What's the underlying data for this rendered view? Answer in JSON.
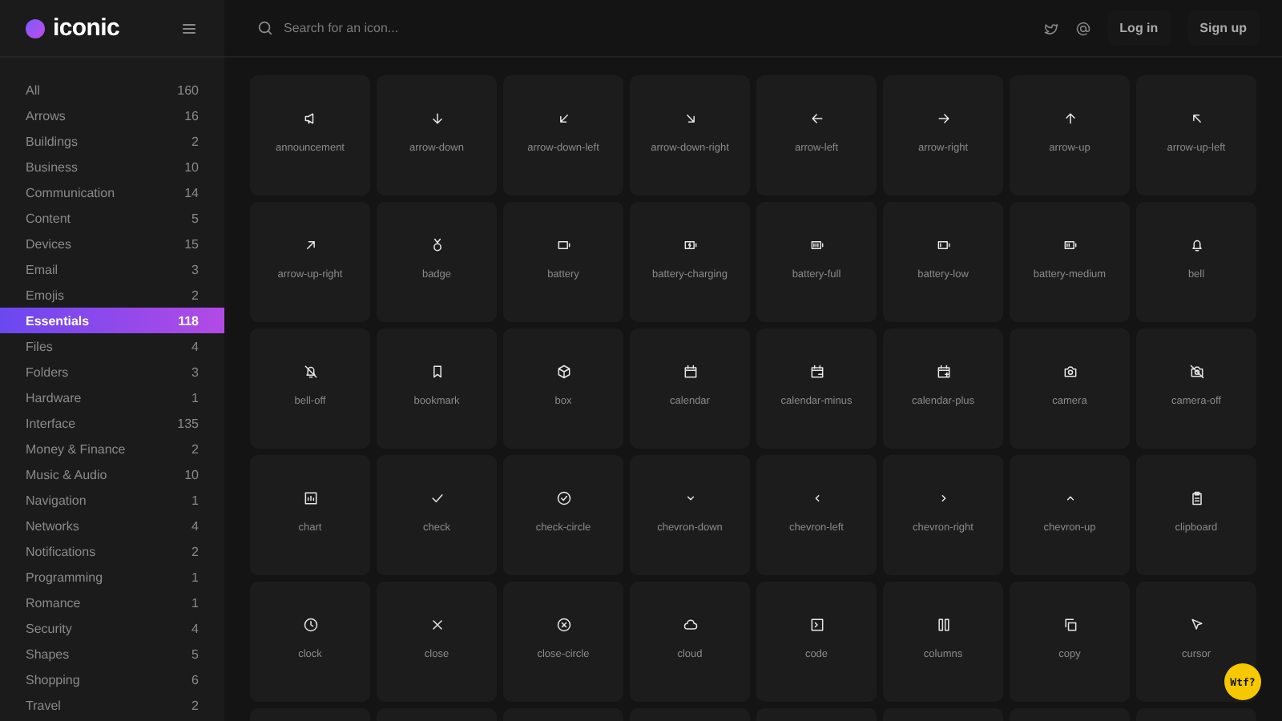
{
  "logo": {
    "text": "iconic"
  },
  "sidebar": {
    "items": [
      {
        "label": "All",
        "count": "160",
        "selected": false
      },
      {
        "label": "Arrows",
        "count": "16",
        "selected": false
      },
      {
        "label": "Buildings",
        "count": "2",
        "selected": false
      },
      {
        "label": "Business",
        "count": "10",
        "selected": false
      },
      {
        "label": "Communication",
        "count": "14",
        "selected": false
      },
      {
        "label": "Content",
        "count": "5",
        "selected": false
      },
      {
        "label": "Devices",
        "count": "15",
        "selected": false
      },
      {
        "label": "Email",
        "count": "3",
        "selected": false
      },
      {
        "label": "Emojis",
        "count": "2",
        "selected": false
      },
      {
        "label": "Essentials",
        "count": "118",
        "selected": true
      },
      {
        "label": "Files",
        "count": "4",
        "selected": false
      },
      {
        "label": "Folders",
        "count": "3",
        "selected": false
      },
      {
        "label": "Hardware",
        "count": "1",
        "selected": false
      },
      {
        "label": "Interface",
        "count": "135",
        "selected": false
      },
      {
        "label": "Money & Finance",
        "count": "2",
        "selected": false
      },
      {
        "label": "Music & Audio",
        "count": "10",
        "selected": false
      },
      {
        "label": "Navigation",
        "count": "1",
        "selected": false
      },
      {
        "label": "Networks",
        "count": "4",
        "selected": false
      },
      {
        "label": "Notifications",
        "count": "2",
        "selected": false
      },
      {
        "label": "Programming",
        "count": "1",
        "selected": false
      },
      {
        "label": "Romance",
        "count": "1",
        "selected": false
      },
      {
        "label": "Security",
        "count": "4",
        "selected": false
      },
      {
        "label": "Shapes",
        "count": "5",
        "selected": false
      },
      {
        "label": "Shopping",
        "count": "6",
        "selected": false
      },
      {
        "label": "Travel",
        "count": "2",
        "selected": false
      }
    ]
  },
  "header": {
    "search": {
      "placeholder": "Search for an icon..."
    },
    "buttons": [
      "Log in",
      "Sign up"
    ]
  },
  "icons": [
    "announcement",
    "arrow-down",
    "arrow-down-left",
    "arrow-down-right",
    "arrow-left",
    "arrow-right",
    "arrow-up",
    "arrow-up-left",
    "arrow-up-right",
    "badge",
    "battery",
    "battery-charging",
    "battery-full",
    "battery-low",
    "battery-medium",
    "bell",
    "bell-off",
    "bookmark",
    "box",
    "calendar",
    "calendar-minus",
    "calendar-plus",
    "camera",
    "camera-off",
    "chart",
    "check",
    "check-circle",
    "chevron-down",
    "chevron-left",
    "chevron-right",
    "chevron-up",
    "clipboard",
    "clock",
    "close",
    "close-circle",
    "cloud",
    "code",
    "columns",
    "copy",
    "cursor"
  ],
  "feedback_button": {
    "label": "Wtf?"
  }
}
